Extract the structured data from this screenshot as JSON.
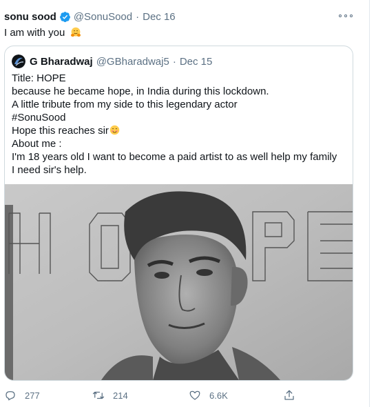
{
  "tweet": {
    "author_name": "sonu sood",
    "author_handle": "@SonuSood",
    "separator": "·",
    "date": "Dec 16",
    "text": "I am with you"
  },
  "quoted": {
    "author_name": "G Bharadwaj",
    "author_handle": "@GBharadwaj5",
    "separator": "·",
    "date": "Dec 15",
    "lines": [
      "Title: HOPE",
      "because he became hope, in India during this lockdown.",
      "A little tribute from my side to this legendary actor",
      "#SonuSood",
      "Hope this reaches sir",
      "About me :",
      "I'm 18 years old I want to become a paid artist to as well help my family",
      "I need sir's help."
    ],
    "image": {
      "drawn_letters": "HOPE"
    }
  },
  "actions": {
    "replies": "277",
    "retweets": "214",
    "likes": "6.6K"
  },
  "colors": {
    "text": "#0f1419",
    "secondary": "#5b7083",
    "verified": "#1d9bf0",
    "border": "#cfd9de"
  },
  "icons": [
    "verified-badge-icon",
    "more-icon",
    "hug-emoji-icon",
    "smile-emoji-icon",
    "reply-icon",
    "retweet-icon",
    "like-icon",
    "share-icon"
  ]
}
